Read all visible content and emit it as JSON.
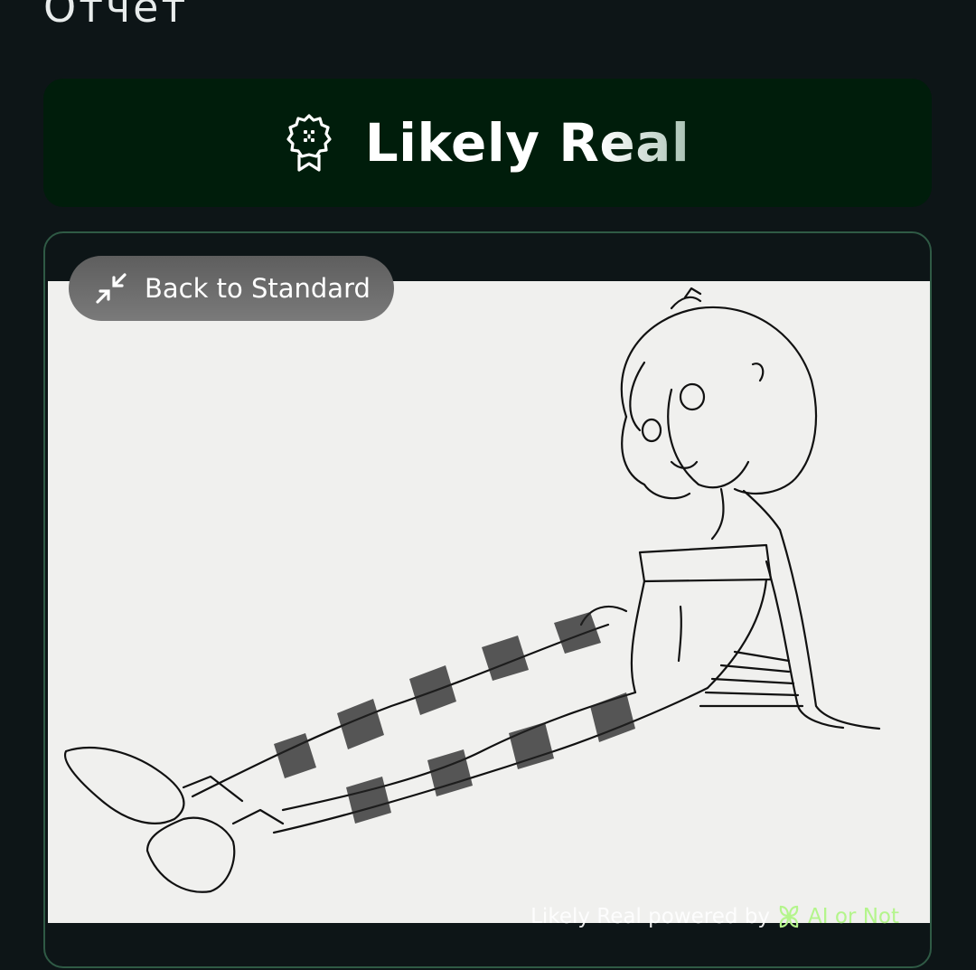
{
  "page": {
    "title": "Отчет"
  },
  "verdict": {
    "label": "Likely Real",
    "icon": "award-ribbon-icon",
    "background_color": "#001d0b"
  },
  "image_panel": {
    "back_button_label": "Back to Standard",
    "back_button_icon": "collapse-arrows-icon",
    "watermark": {
      "text": "Likely Real powered by",
      "brand": "AI or Not",
      "brand_icon": "clover-logo-icon",
      "brand_color": "#b4f58c"
    },
    "border_color": "#2f5a45"
  }
}
